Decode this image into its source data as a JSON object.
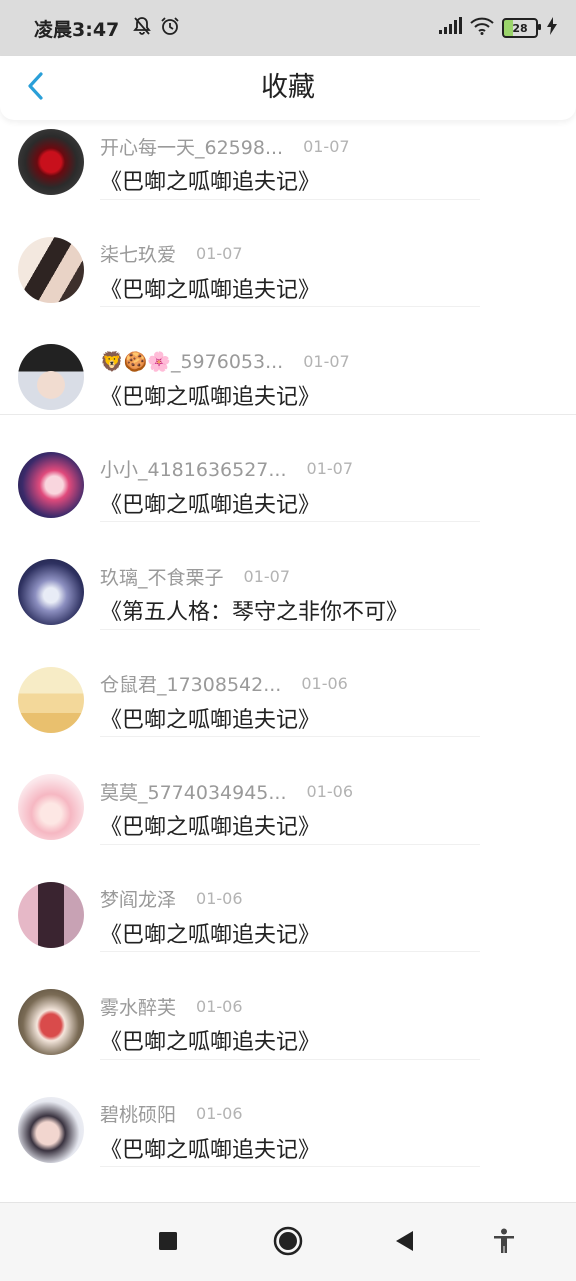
{
  "status_bar": {
    "time": "凌晨3:47",
    "battery": "28"
  },
  "header": {
    "title": "收藏"
  },
  "items": [
    {
      "user": "开心每一天_62598...",
      "date": "01-07",
      "title": "《巴啣之呱啣追夫记》",
      "avatar_icon": "red-rose-icon"
    },
    {
      "user": "柒七玖爱",
      "date": "01-07",
      "title": "《巴啣之呱啣追夫记》",
      "avatar_icon": "anime-couple-icon"
    },
    {
      "user": "🦁🍪🌸_5976053...",
      "date": "01-07",
      "title": "《巴啣之呱啣追夫记》",
      "avatar_icon": "boy-portrait-icon"
    },
    {
      "user": "小小_4181636527...",
      "date": "01-07",
      "title": "《巴啣之呱啣追夫记》",
      "avatar_icon": "pink-anime-girl-icon"
    },
    {
      "user": "玖璃_不食栗子",
      "date": "01-07",
      "title": "《第五人格：琴守之非你不可》",
      "avatar_icon": "starry-girl-icon"
    },
    {
      "user": "仓鼠君_17308542...",
      "date": "01-06",
      "title": "《巴啣之呱啣追夫记》",
      "avatar_icon": "bakery-icon"
    },
    {
      "user": "莫莫_5774034945...",
      "date": "01-06",
      "title": "《巴啣之呱啣追夫记》",
      "avatar_icon": "cherry-anime-girl-icon"
    },
    {
      "user": "梦阎龙泽",
      "date": "01-06",
      "title": "《巴啣之呱啣追夫记》",
      "avatar_icon": "dark-hair-girl-icon"
    },
    {
      "user": "雾水醉芙",
      "date": "01-06",
      "title": "《巴啣之呱啣追夫记》",
      "avatar_icon": "sneakers-icon"
    },
    {
      "user": "碧桃硕阳",
      "date": "01-06",
      "title": "《巴啣之呱啣追夫记》",
      "avatar_icon": "face-portrait-icon"
    }
  ],
  "colors": {
    "accent": "#2a9fd8",
    "divider": "#f0f0f0"
  }
}
